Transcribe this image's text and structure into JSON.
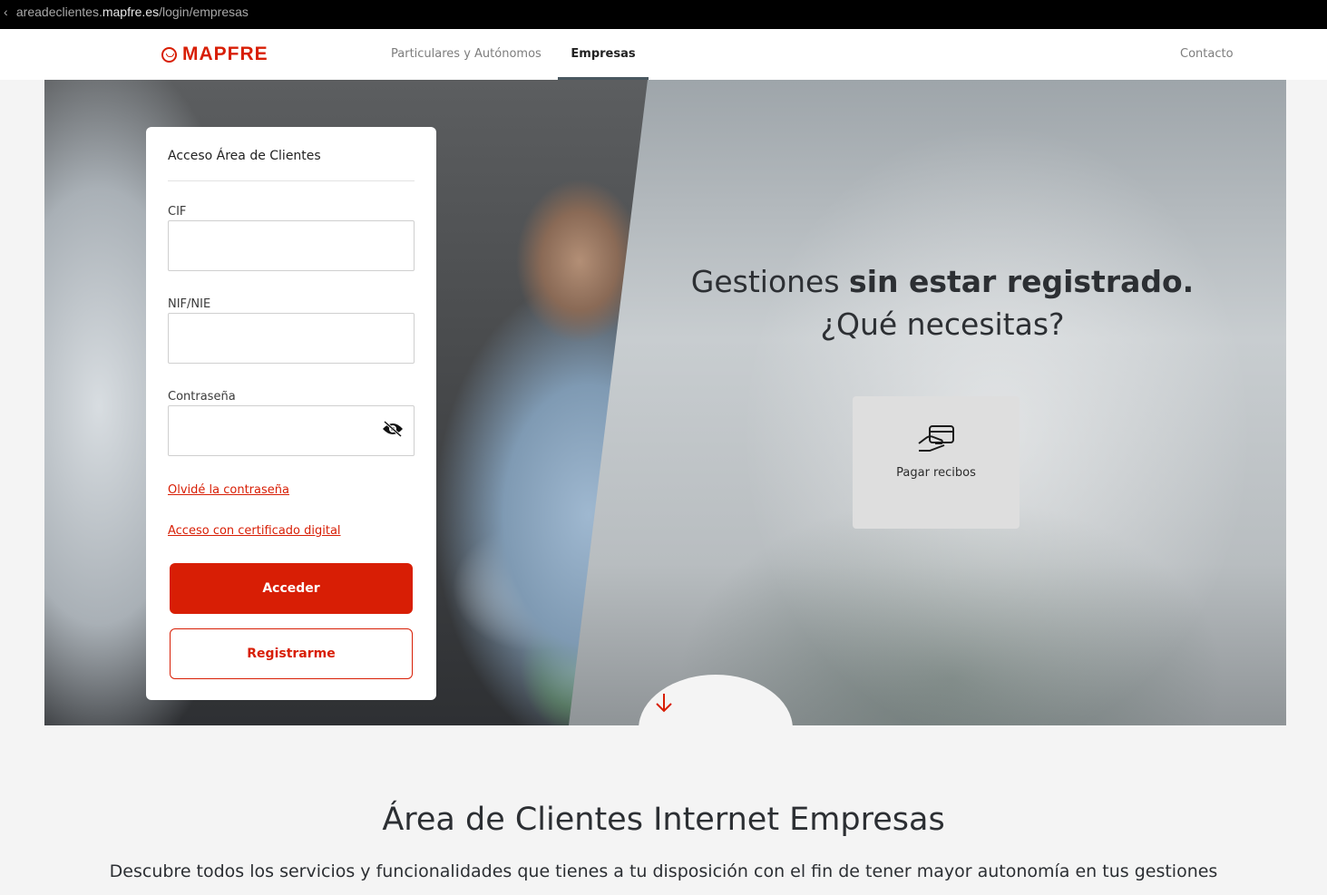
{
  "browser": {
    "url_prefix": "areadeclientes.",
    "url_host": "mapfre.es",
    "url_path": "/login/empresas"
  },
  "nav": {
    "logo_text": "MAPFRE",
    "particulares": "Particulares y Autónomos",
    "empresas": "Empresas",
    "contacto": "Contacto"
  },
  "login": {
    "title": "Acceso Área de Clientes",
    "cif_label": "CIF",
    "cif_value": "",
    "nif_label": "NIF/NIE",
    "nif_value": "",
    "password_label": "Contraseña",
    "password_value": "",
    "forgot_link": "Olvidé la contraseña",
    "certificate_link": "Acceso con certificado digital",
    "submit": "Acceder",
    "register": "Registrarme"
  },
  "hero": {
    "title_part1": "Gestiones ",
    "title_bold": "sin estar registrado.",
    "title_line2": "¿Qué necesitas?",
    "pay_label": "Pagar recibos"
  },
  "section": {
    "title": "Área de Clientes Internet Empresas",
    "subtitle": "Descubre todos los servicios y funcionalidades que tienes a tu disposición con el fin de tener mayor autonomía en tus gestiones"
  },
  "colors": {
    "brand": "#d81e05",
    "text_dark": "#2c2f33"
  },
  "icons": {
    "eye": "eye-off-icon",
    "pay": "hand-card-icon",
    "scroll": "arrow-down-icon",
    "logo": "mapfre-logo-icon"
  }
}
